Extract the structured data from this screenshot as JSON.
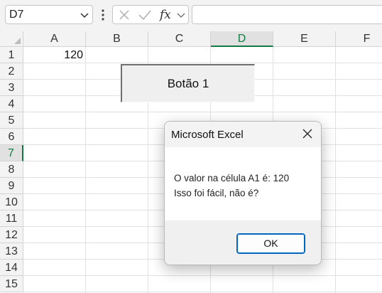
{
  "formula_bar": {
    "name_box": "D7",
    "fx_label": "fx",
    "formula": ""
  },
  "grid": {
    "columns": [
      "A",
      "B",
      "C",
      "D",
      "E",
      "F"
    ],
    "rows": [
      "1",
      "2",
      "3",
      "4",
      "5",
      "6",
      "7",
      "8",
      "9",
      "10",
      "11",
      "12",
      "13",
      "14",
      "15"
    ],
    "selected_column": "D",
    "selected_row": "7",
    "cells": {
      "A1": "120",
      "D7": ""
    }
  },
  "form_button": {
    "label": "Botão 1"
  },
  "dialog": {
    "title": "Microsoft Excel",
    "message_line1": "O valor na célula A1 é: 120",
    "message_line2": "Isso foi fácil, não é?",
    "ok_label": "OK"
  },
  "colors": {
    "accent": "#107c41",
    "ok_border": "#0067c0"
  }
}
